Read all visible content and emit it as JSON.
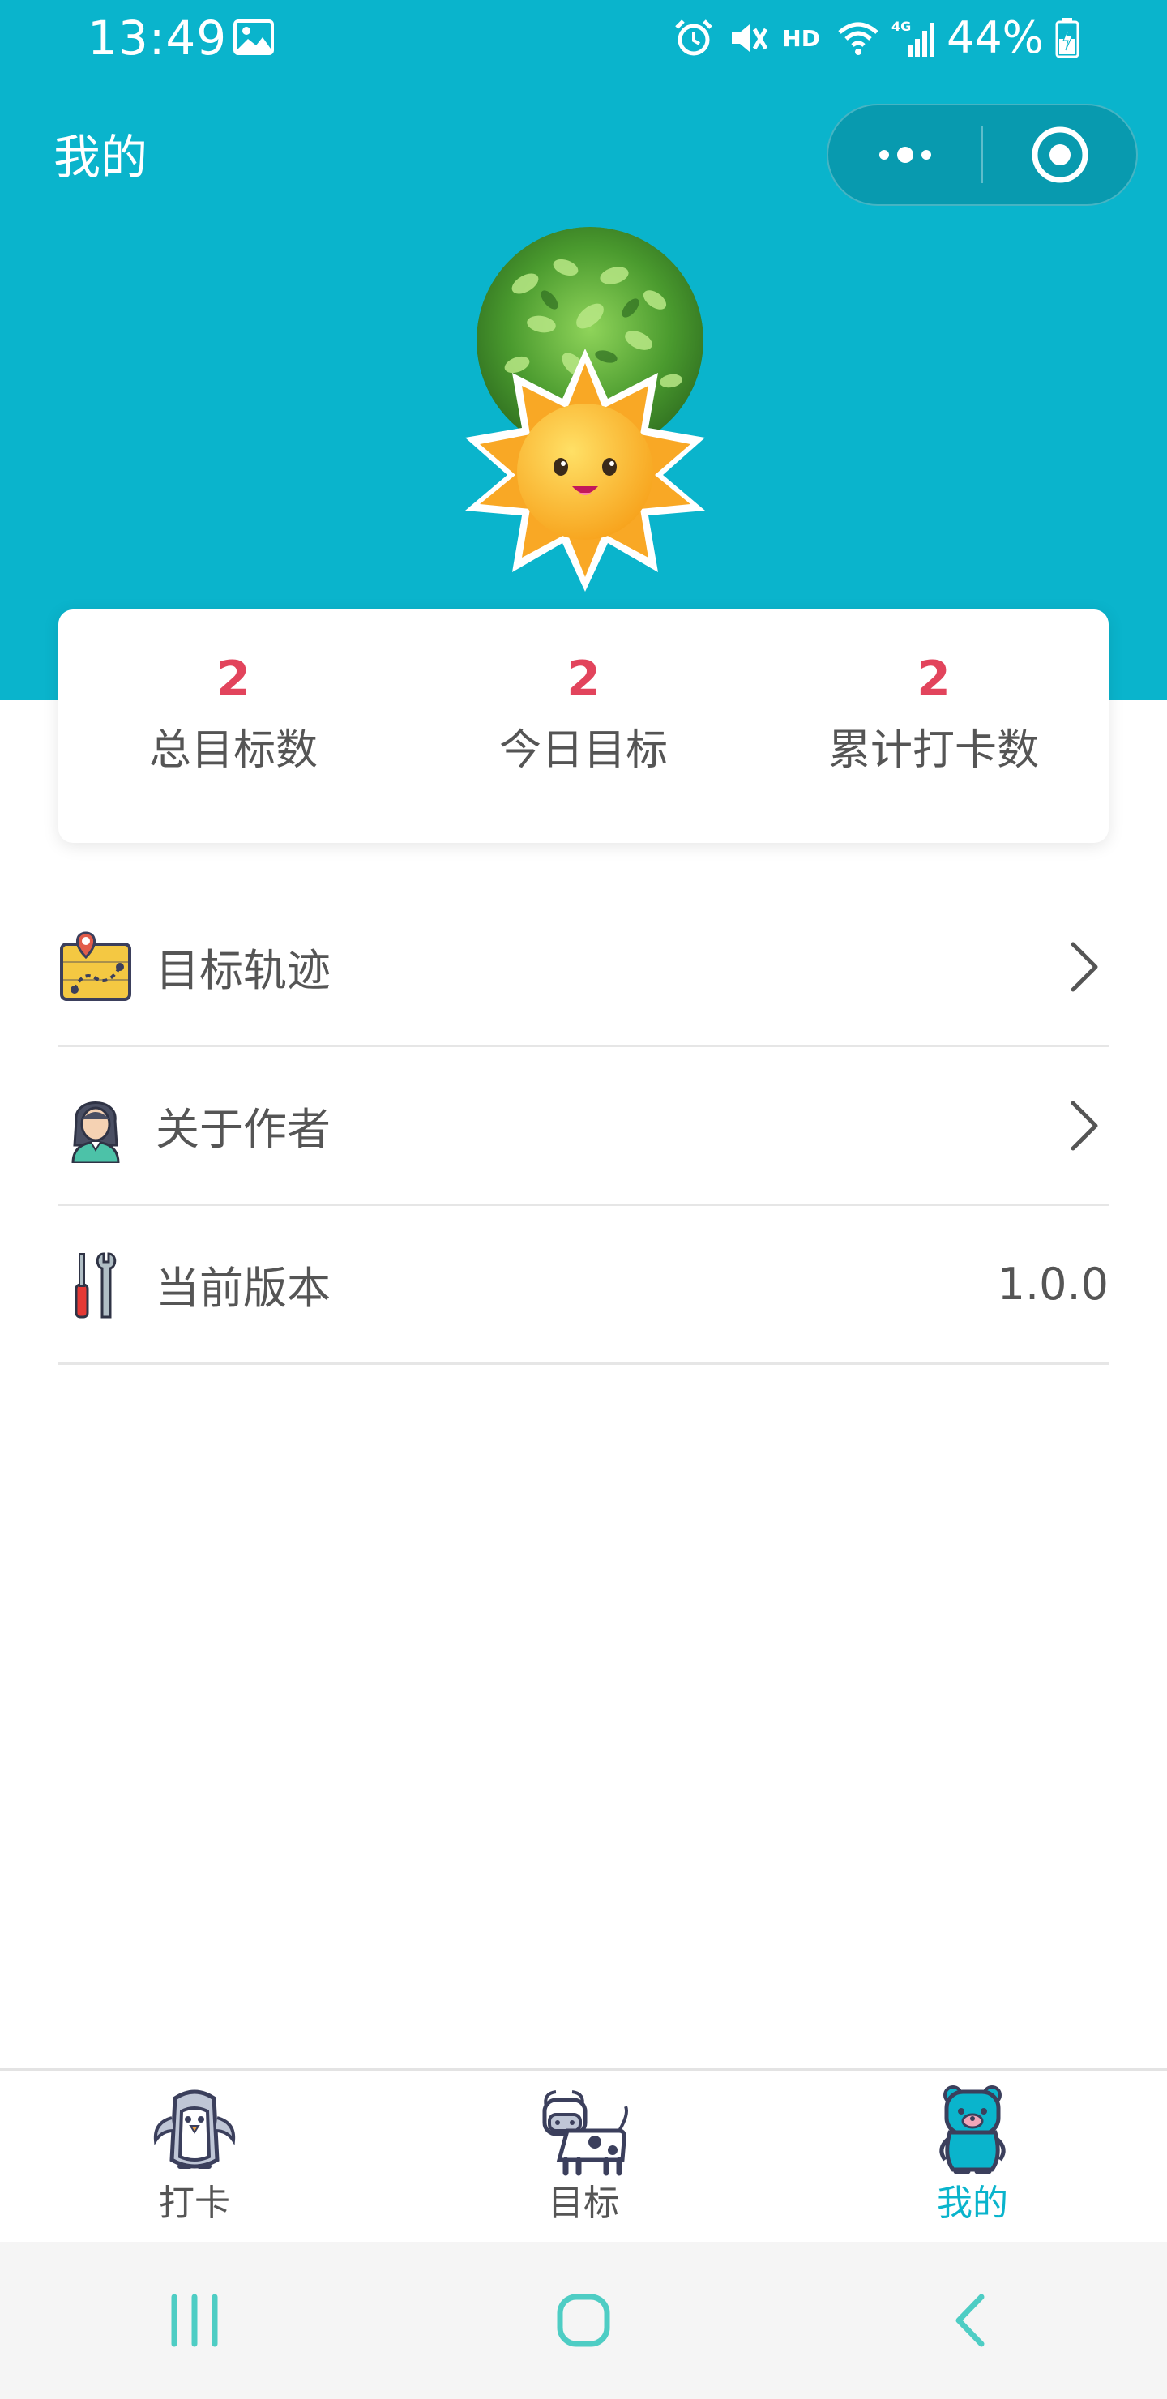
{
  "status_bar": {
    "time": "13:49",
    "hd": "HD",
    "network": "4G",
    "battery": "44%"
  },
  "header": {
    "title": "我的",
    "accent_color": "#0ab4cc"
  },
  "stats": [
    {
      "value": "2",
      "label": "总目标数"
    },
    {
      "value": "2",
      "label": "今日目标"
    },
    {
      "value": "2",
      "label": "累计打卡数"
    }
  ],
  "menu": [
    {
      "label": "目标轨迹",
      "icon": "map-route-icon",
      "chevron": true
    },
    {
      "label": "关于作者",
      "icon": "author-avatar-icon",
      "chevron": true
    },
    {
      "label": "当前版本",
      "icon": "tools-icon",
      "value": "1.0.0"
    }
  ],
  "tabs": [
    {
      "label": "打卡",
      "icon": "penguin-icon",
      "active": false
    },
    {
      "label": "目标",
      "icon": "cow-icon",
      "active": false
    },
    {
      "label": "我的",
      "icon": "bear-icon",
      "active": true
    }
  ],
  "colors": {
    "stat_value": "#e2445c",
    "text": "#555555",
    "divider": "#e6e6e6"
  }
}
